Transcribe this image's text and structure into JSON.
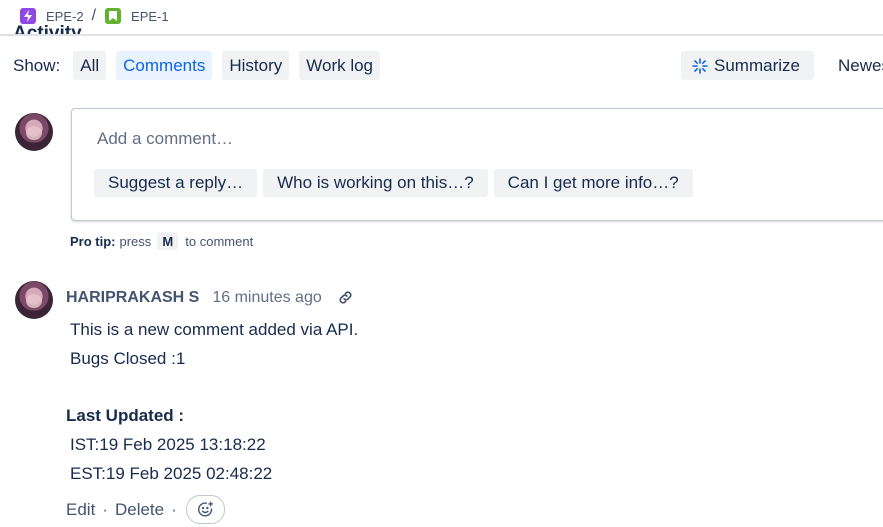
{
  "breadcrumb": {
    "items": [
      {
        "key": "EPE-2",
        "icon": "epic-icon"
      },
      {
        "key": "EPE-1",
        "icon": "story-icon"
      }
    ],
    "separator": "/"
  },
  "activity": {
    "title": "Activity",
    "show_label": "Show:",
    "tabs": [
      {
        "label": "All",
        "active": false
      },
      {
        "label": "Comments",
        "active": true
      },
      {
        "label": "History",
        "active": false
      },
      {
        "label": "Work log",
        "active": false
      }
    ],
    "summarize_label": "Summarize",
    "sort_label": "Newest first"
  },
  "composer": {
    "placeholder": "Add a comment…",
    "suggestions": [
      "Suggest a reply…",
      "Who is working on this…?",
      "Can I get more info…?"
    ],
    "protip": {
      "label": "Pro tip:",
      "pre": "press",
      "key": "M",
      "post": "to comment"
    }
  },
  "comment": {
    "author": "HARIPRAKASH S",
    "time": "16 minutes ago",
    "lines": [
      "This is a new comment added via API.",
      "Bugs Closed :1"
    ],
    "updated_label": "Last Updated :",
    "ist": "IST:19 Feb 2025 13:18:22",
    "est": "EST:19 Feb 2025 02:48:22",
    "actions": {
      "edit": "Edit",
      "delete": "Delete",
      "separator": "·"
    }
  },
  "colors": {
    "accent": "#0c66e4",
    "epic": "#8f48e4",
    "story": "#62b22f",
    "text": "#172b4d"
  }
}
